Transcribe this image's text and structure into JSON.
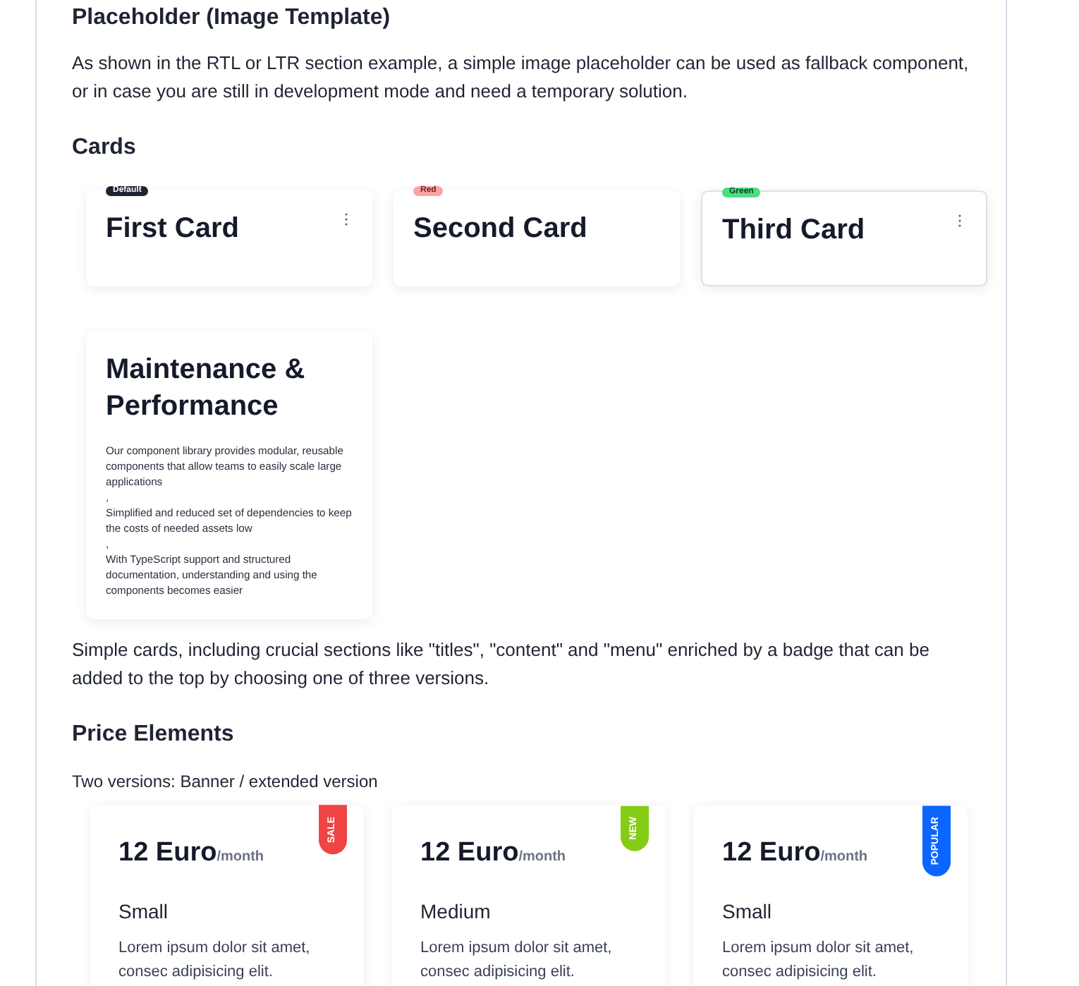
{
  "sections": [
    {
      "kind": "text",
      "heading": "Placeholder (Image Template)",
      "paragraph": "As shown in the RTL or LTR section example, a simple image placeholder can be used as fallback component, or in case you are still in development mode and need a temporary solution."
    },
    {
      "kind": "cards",
      "heading": "Cards",
      "cards": [
        {
          "badge": "Default",
          "color": "#1e2235",
          "title": "First Card",
          "menu": true,
          "bordered": false
        },
        {
          "badge": "Red",
          "color": "#f8a5a5",
          "title": "Second Card",
          "menu": false,
          "bordered": false
        },
        {
          "badge": "Green",
          "color": "#4ade80",
          "title": "Third Card",
          "menu": true,
          "bordered": true
        }
      ],
      "feature_card": {
        "title": "Maintenance & Performance",
        "lines": [
          "Our component library provides modular, reusable components that allow teams to easily scale large applications",
          ",",
          "Simplified and reduced set of dependencies to keep the costs of needed assets low",
          ",",
          "With TypeScript support and structured documentation, understanding and using the components becomes easier"
        ]
      },
      "paragraph": "Simple cards, including crucial sections like \"titles\", \"content\" and \"menu\" enriched by a badge that can be added to the top by choosing one of three versions."
    },
    {
      "kind": "prices",
      "heading": "Price Elements",
      "subtitle": "Two versions: Banner / extended version",
      "prices": [
        {
          "price": "12 Euro",
          "period": "/month",
          "ribbon": "SALE",
          "color": "#ef4444",
          "plan": "Small",
          "description": "Lorem ipsum dolor sit amet, consec adipisicing elit."
        },
        {
          "price": "12 Euro",
          "period": "/month",
          "ribbon": "NEW",
          "color": "#84cc16",
          "plan": "Medium",
          "description": "Lorem ipsum dolor sit amet, consec adipisicing elit."
        },
        {
          "price": "12 Euro",
          "period": "/month",
          "ribbon": "POPULAR",
          "color": "#0a66ff",
          "plan": "Small",
          "description": "Lorem ipsum dolor sit amet, consec adipisicing elit."
        }
      ]
    }
  ]
}
